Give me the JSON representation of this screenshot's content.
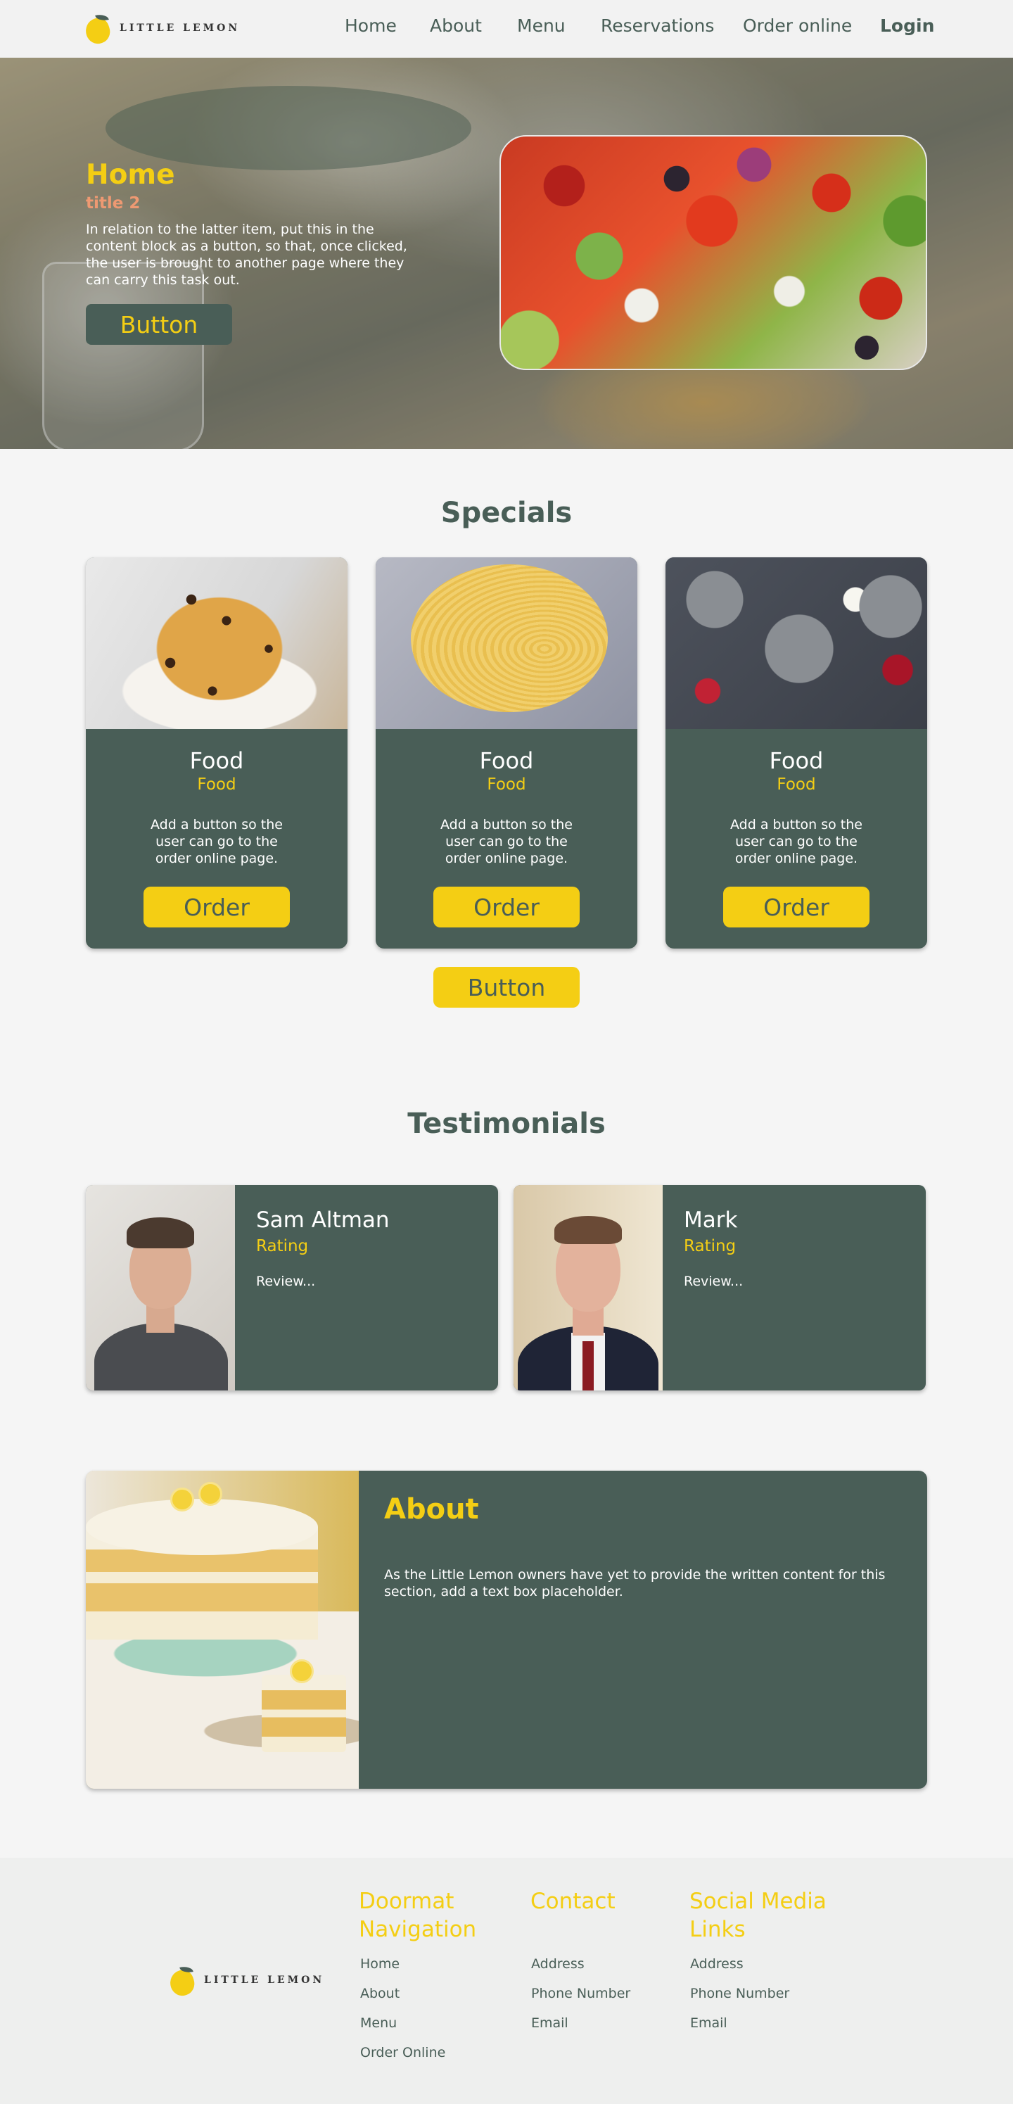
{
  "brand": {
    "name": "LITTLE LEMON",
    "colors": {
      "primary": "#495e57",
      "accent": "#f4ce14",
      "highlight": "#ee9972"
    }
  },
  "nav": {
    "items": [
      "Home",
      "About",
      "Menu",
      "Reservations",
      "Order online"
    ],
    "login": "Login"
  },
  "hero": {
    "title": "Home",
    "subtitle": "title 2",
    "text": "In relation to the latter item, put this in the content block as a button, so that, once clicked, the user is brought to another page where they can carry this task out.",
    "button": "Button"
  },
  "specials": {
    "title": "Specials",
    "cards": [
      {
        "title": "Food",
        "subtitle": "Food",
        "text": "Add a button so the user can go to the order online page.",
        "button": "Order",
        "image_icon": "blondie-bars-photo"
      },
      {
        "title": "Food",
        "subtitle": "Food",
        "text": "Add a button so the user can go to the order online page.",
        "button": "Order",
        "image_icon": "pasta-photo"
      },
      {
        "title": "Food",
        "subtitle": "Food",
        "text": "Add a button so the user can go to the order online page.",
        "button": "Order",
        "image_icon": "cake-slices-photo"
      }
    ],
    "button": "Button"
  },
  "testimonials": {
    "title": "Testimonials",
    "items": [
      {
        "name": "Sam Altman",
        "rating": "Rating",
        "review": "Review..."
      },
      {
        "name": "Mark",
        "rating": "Rating",
        "review": "Review..."
      }
    ]
  },
  "about": {
    "title": "About",
    "text": "As the Little Lemon owners have yet to provide the written content for this section, add a text box placeholder."
  },
  "footer": {
    "brand": "LITTLE LEMON",
    "columns": [
      {
        "title": "Doormat Navigation",
        "links": [
          "Home",
          "About",
          "Menu",
          "Order Online"
        ]
      },
      {
        "title": "Contact",
        "links": [
          "Address",
          "Phone Number",
          "Email"
        ]
      },
      {
        "title": "Social Media Links",
        "links": [
          "Address",
          "Phone Number",
          "Email"
        ]
      }
    ]
  }
}
